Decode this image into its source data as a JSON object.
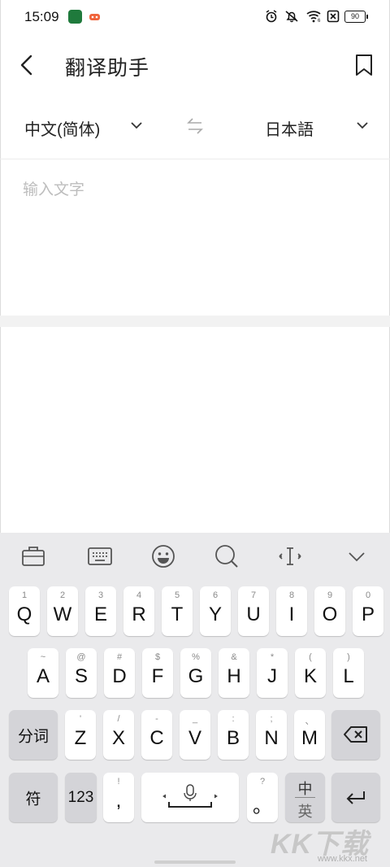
{
  "status_bar": {
    "time": "15:09",
    "battery": "90"
  },
  "header": {
    "title": "翻译助手"
  },
  "languages": {
    "source": "中文(简体)",
    "target": "日本語"
  },
  "input": {
    "placeholder": "输入文字"
  },
  "keyboard": {
    "row1": [
      {
        "sub": "1",
        "main": "Q"
      },
      {
        "sub": "2",
        "main": "W"
      },
      {
        "sub": "3",
        "main": "E"
      },
      {
        "sub": "4",
        "main": "R"
      },
      {
        "sub": "5",
        "main": "T"
      },
      {
        "sub": "6",
        "main": "Y"
      },
      {
        "sub": "7",
        "main": "U"
      },
      {
        "sub": "8",
        "main": "I"
      },
      {
        "sub": "9",
        "main": "O"
      },
      {
        "sub": "0",
        "main": "P"
      }
    ],
    "row2": [
      {
        "sub": "~",
        "main": "A"
      },
      {
        "sub": "@",
        "main": "S"
      },
      {
        "sub": "#",
        "main": "D"
      },
      {
        "sub": "$",
        "main": "F"
      },
      {
        "sub": "%",
        "main": "G"
      },
      {
        "sub": "&",
        "main": "H"
      },
      {
        "sub": "*",
        "main": "J"
      },
      {
        "sub": "(",
        "main": "K"
      },
      {
        "sub": ")",
        "main": "L"
      }
    ],
    "row3_left": "分词",
    "row3": [
      {
        "sub": "'",
        "main": "Z"
      },
      {
        "sub": "/",
        "main": "X"
      },
      {
        "sub": "-",
        "main": "C"
      },
      {
        "sub": "_",
        "main": "V"
      },
      {
        "sub": ":",
        "main": "B"
      },
      {
        "sub": ";",
        "main": "N"
      },
      {
        "sub": "、",
        "main": "M"
      }
    ],
    "symbol_key": "符",
    "num_key": "123",
    "comma_key": {
      "sub": "!",
      "main": ","
    },
    "period_key": {
      "sub": "?",
      "main": "。"
    },
    "lang_key_top": "中",
    "lang_key_bottom": "英"
  },
  "watermark": {
    "logo": "KK下载",
    "url": "www.kkx.net"
  }
}
